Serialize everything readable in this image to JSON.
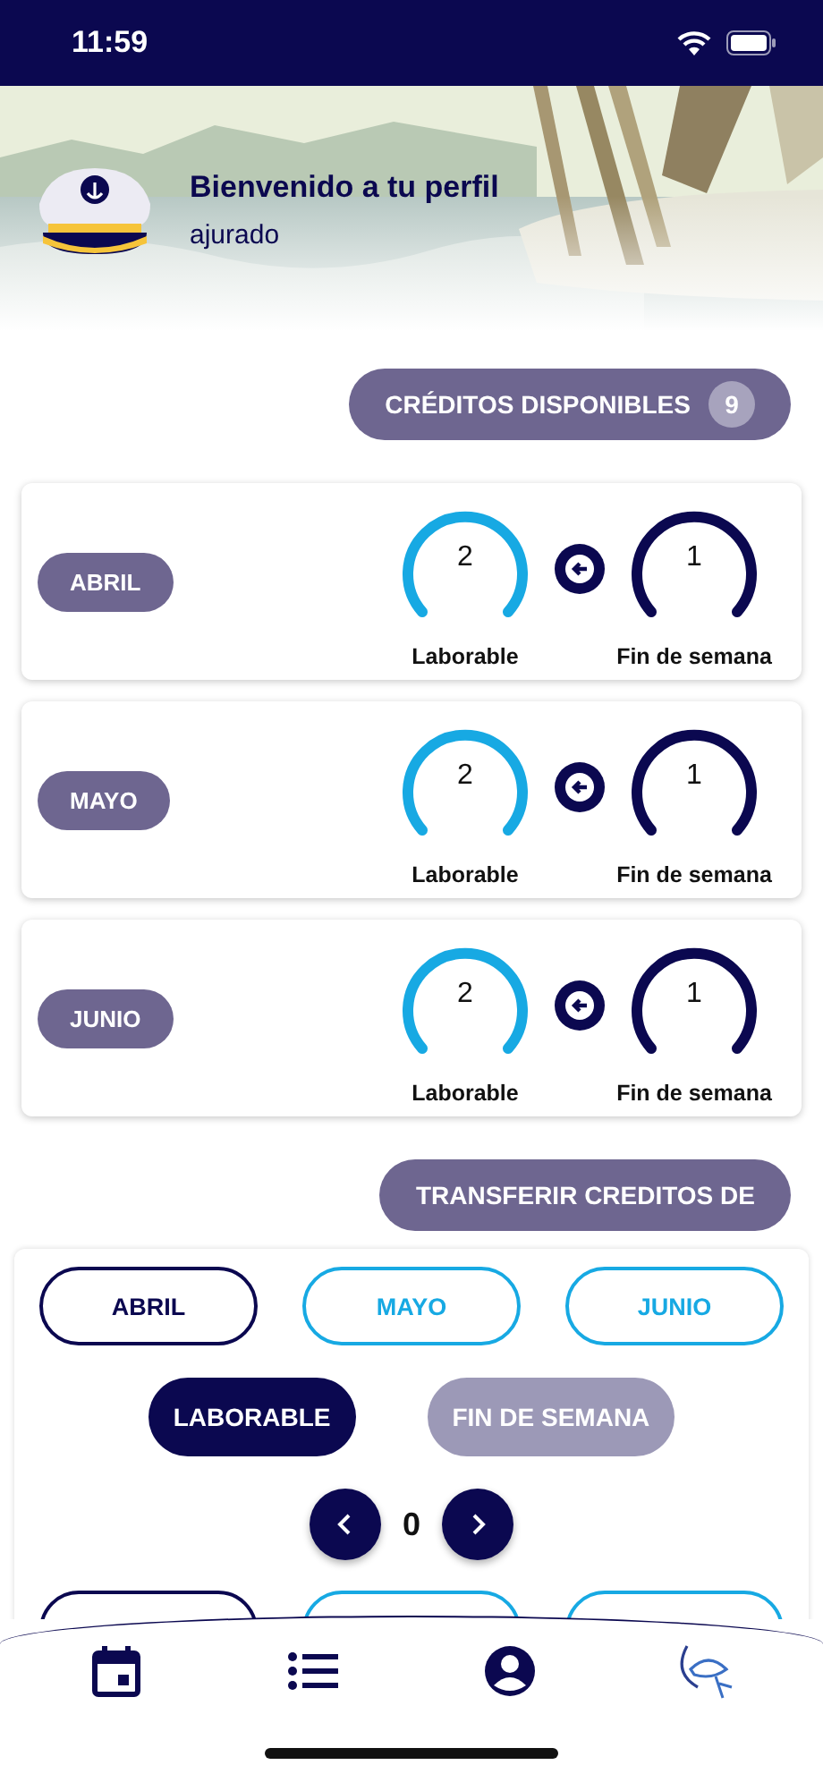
{
  "status_bar": {
    "time": "11:59"
  },
  "profile": {
    "title": "Bienvenido a tu perfil",
    "username": "ajurado"
  },
  "credits": {
    "label": "CRÉDITOS DISPONIBLES",
    "count": "9"
  },
  "months": [
    {
      "name": "ABRIL",
      "weekday_credits": "2",
      "weekday_label": "Laborable",
      "weekend_credits": "1",
      "weekend_label": "Fin de semana"
    },
    {
      "name": "MAYO",
      "weekday_credits": "2",
      "weekday_label": "Laborable",
      "weekend_credits": "1",
      "weekend_label": "Fin de semana"
    },
    {
      "name": "JUNIO",
      "weekday_credits": "2",
      "weekday_label": "Laborable",
      "weekend_credits": "1",
      "weekend_label": "Fin de semana"
    }
  ],
  "transfer": {
    "title": "TRANSFERIR CREDITOS DE",
    "from_months": [
      {
        "label": "ABRIL",
        "selected": true
      },
      {
        "label": "MAYO",
        "selected": false
      },
      {
        "label": "JUNIO",
        "selected": false
      }
    ],
    "types": [
      {
        "label": "LABORABLE",
        "selected": true
      },
      {
        "label": "FIN DE SEMANA",
        "selected": false
      }
    ],
    "amount": "0",
    "to_months": [
      {
        "selected": true
      },
      {
        "selected": false
      },
      {
        "selected": false
      }
    ]
  },
  "tab_bar": {
    "items": [
      {
        "kind": "calendar"
      },
      {
        "kind": "list"
      },
      {
        "kind": "profile"
      },
      {
        "kind": "logo"
      }
    ]
  }
}
